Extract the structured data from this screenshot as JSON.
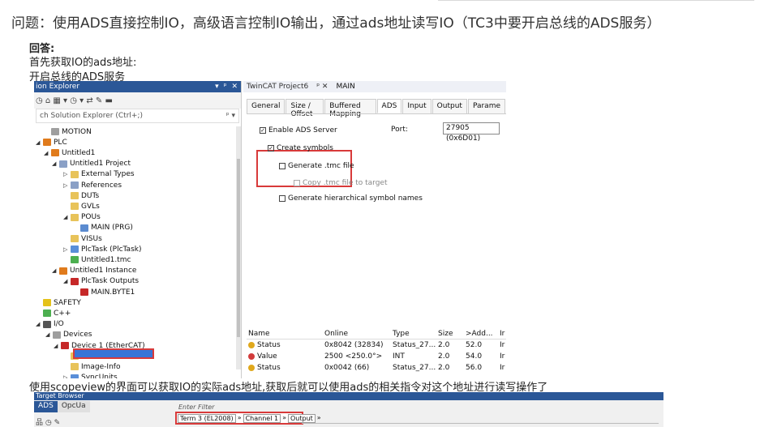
{
  "article": {
    "question": "问题：使用ADS直接控制IO，高级语言控制IO输出，通过ads地址读写IO（TC3中要开启总线的ADS服务）",
    "answer_heading": "回答:",
    "step1": "首先获取IO的ads地址:",
    "step2": "开启总线的ADS服务",
    "step3": "使用scopeview的界面可以获取IO的实际ads地址,获取后就可以使用ads的相关指令对这个地址进行读写操作了"
  },
  "solution_explorer": {
    "title": "ion Explorer",
    "title_buttons": [
      "▾",
      "ᵖ",
      "✕"
    ],
    "toolbar": "◷ ⌂ ▦ ▾   ◷ ▾ ⇄   ✎ ▬",
    "search_placeholder": "ch Solution Explorer (Ctrl+;)",
    "search_icon": "ᵖ ▾",
    "tree": [
      {
        "label": "MOTION",
        "icon": "gray",
        "exp": ""
      },
      {
        "label": "PLC",
        "icon": "plc",
        "exp": "◢"
      },
      {
        "label": "Untitled1",
        "icon": "plc",
        "exp": "◢"
      },
      {
        "label": "Untitled1 Project",
        "icon": "proj",
        "exp": "◢"
      },
      {
        "label": "External Types",
        "icon": "folder",
        "exp": "▷"
      },
      {
        "label": "References",
        "icon": "proj",
        "exp": "▷"
      },
      {
        "label": "DUTs",
        "icon": "folder",
        "exp": ""
      },
      {
        "label": "GVLs",
        "icon": "folder",
        "exp": ""
      },
      {
        "label": "POUs",
        "icon": "folder",
        "exp": "◢"
      },
      {
        "label": "MAIN (PRG)",
        "icon": "file",
        "exp": ""
      },
      {
        "label": "VISUs",
        "icon": "folder",
        "exp": ""
      },
      {
        "label": "PlcTask (PlcTask)",
        "icon": "task",
        "exp": "▷"
      },
      {
        "label": "Untitled1.tmc",
        "icon": "green",
        "exp": ""
      },
      {
        "label": "Untitled1 Instance",
        "icon": "plc",
        "exp": "◢"
      },
      {
        "label": "PlcTask Outputs",
        "icon": "red",
        "exp": "◢"
      },
      {
        "label": "MAIN.BYTE1",
        "icon": "red",
        "exp": ""
      },
      {
        "label": "SAFETY",
        "icon": "yellow",
        "exp": ""
      },
      {
        "label": "C++",
        "icon": "green",
        "exp": ""
      },
      {
        "label": "I/O",
        "icon": "io",
        "exp": "◢"
      },
      {
        "label": "Devices",
        "icon": "gray",
        "exp": "◢"
      },
      {
        "label": "Device 1 (EtherCAT)",
        "icon": "red",
        "exp": "◢"
      },
      {
        "label": "Image",
        "icon": "folder",
        "exp": ""
      },
      {
        "label": "Image-Info",
        "icon": "folder",
        "exp": ""
      },
      {
        "label": "SyncUnits",
        "icon": "task",
        "exp": "▷"
      }
    ]
  },
  "doc_tabs": [
    "TwinCAT Project6",
    "ᵖ  ✕",
    "MAIN"
  ],
  "property_tabs": [
    "General",
    "Size / Offset",
    "Buffered Mapping",
    "ADS",
    "Input",
    "Output",
    "Parame"
  ],
  "ads_settings": {
    "enable_ads_server": "Enable ADS Server",
    "create_symbols": "Create symbols",
    "generate_tmc": "Generate .tmc file",
    "copy_tmc": "Copy .tmc file to target",
    "generate_hier": "Generate hierarchical symbol names",
    "port_label": "Port:",
    "port_value": "27905 (0x6D01)"
  },
  "variables": {
    "columns": [
      "Name",
      "Online",
      "Type",
      "Size",
      ">Add...",
      "Ir"
    ],
    "rows": [
      {
        "name": "Status",
        "online": "0x8042 (32834)",
        "type": "Status_27...",
        "size": "2.0",
        "addr": "52.0",
        "in": "Ir",
        "dir": "in"
      },
      {
        "name": "Value",
        "online": "2500 <250.0°>",
        "type": "INT",
        "size": "2.0",
        "addr": "54.0",
        "in": "Ir",
        "dir": "in"
      },
      {
        "name": "Status",
        "online": "0x0042 (66)",
        "type": "Status_27...",
        "size": "2.0",
        "addr": "56.0",
        "in": "Ir",
        "dir": "in"
      }
    ]
  },
  "target_browser": {
    "title": "Target Browser",
    "tabs": [
      "ADS",
      "OpcUa"
    ],
    "tools": "品 ◷ ✎",
    "filter_label": "Enter Filter",
    "crumbs": [
      "Term 3 (EL2008)",
      "»",
      "Channel 1",
      "»",
      "Output",
      "»"
    ]
  }
}
